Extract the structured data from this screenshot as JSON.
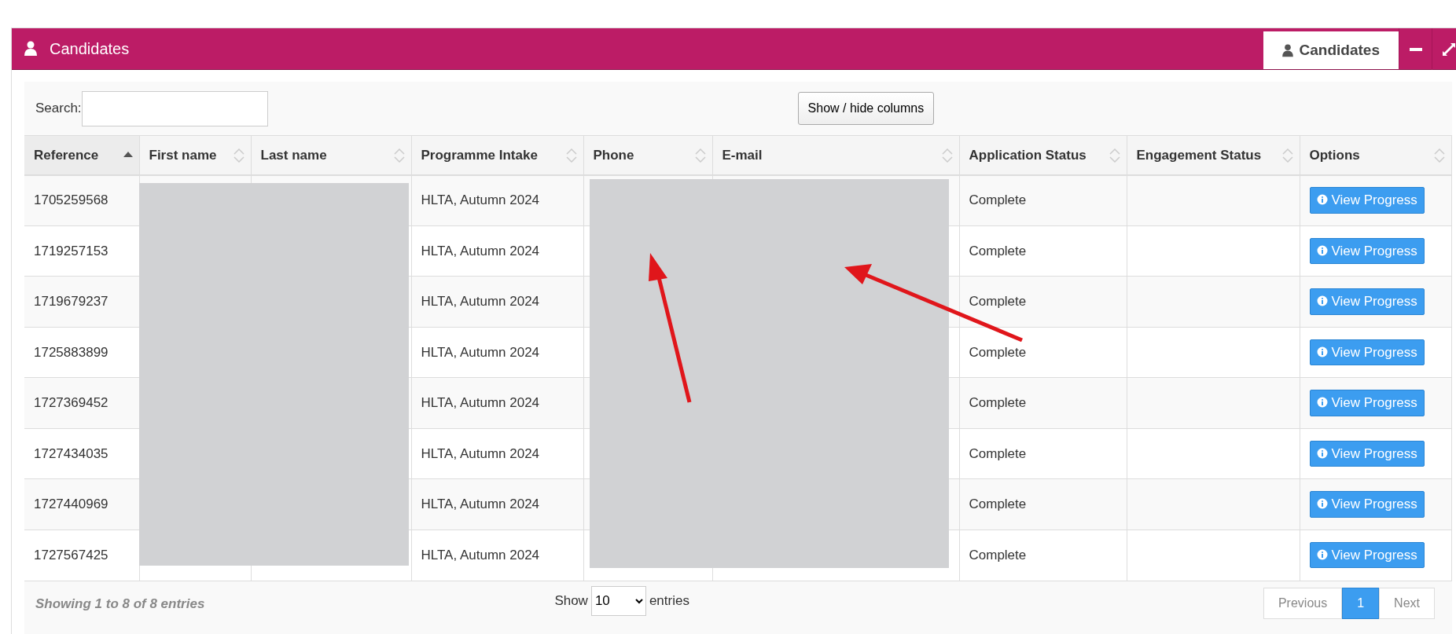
{
  "panel": {
    "title": "Candidates",
    "tabs": [
      {
        "label": "Candidates",
        "selected": true
      }
    ]
  },
  "search": {
    "label": "Search:"
  },
  "columns_button": "Show / hide columns",
  "table": {
    "columns": [
      {
        "label": "Reference",
        "sorted": true
      },
      {
        "label": "First name",
        "sorted": false
      },
      {
        "label": "Last name",
        "sorted": false
      },
      {
        "label": "Programme Intake",
        "sorted": false
      },
      {
        "label": "Phone",
        "sorted": false
      },
      {
        "label": "E-mail",
        "sorted": false
      },
      {
        "label": "Application Status",
        "sorted": false
      },
      {
        "label": "Engagement Status",
        "sorted": false
      },
      {
        "label": "Options",
        "sorted": false
      }
    ],
    "rows": [
      {
        "reference": "1705259568",
        "programme": "HLTA, Autumn 2024",
        "application_status": "Complete",
        "action": "View Progress"
      },
      {
        "reference": "1719257153",
        "programme": "HLTA, Autumn 2024",
        "application_status": "Complete",
        "action": "View Progress"
      },
      {
        "reference": "1719679237",
        "programme": "HLTA, Autumn 2024",
        "application_status": "Complete",
        "action": "View Progress"
      },
      {
        "reference": "1725883899",
        "programme": "HLTA, Autumn 2024",
        "application_status": "Complete",
        "action": "View Progress"
      },
      {
        "reference": "1727369452",
        "programme": "HLTA, Autumn 2024",
        "application_status": "Complete",
        "action": "View Progress"
      },
      {
        "reference": "1727434035",
        "programme": "HLTA, Autumn 2024",
        "application_status": "Complete",
        "action": "View Progress"
      },
      {
        "reference": "1727440969",
        "programme": "HLTA, Autumn 2024",
        "application_status": "Complete",
        "action": "View Progress"
      },
      {
        "reference": "1727567425",
        "programme": "HLTA, Autumn 2024",
        "application_status": "Complete",
        "action": "View Progress"
      }
    ]
  },
  "footer": {
    "info": "Showing 1 to 8 of 8 entries",
    "length_before": "Show",
    "length_value": "10",
    "length_after": "entries",
    "pages": [
      {
        "label": "Previous",
        "selected": false
      },
      {
        "label": "1",
        "selected": true
      },
      {
        "label": "Next",
        "selected": false
      }
    ]
  }
}
